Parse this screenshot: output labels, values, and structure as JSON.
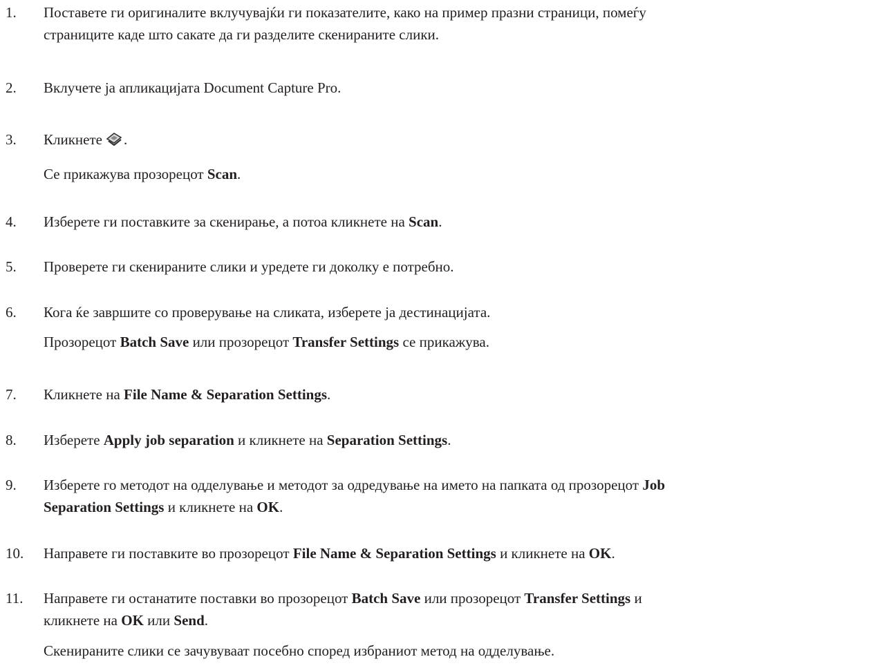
{
  "steps": [
    {
      "num": "1.",
      "line1": "Поставете ги оригиналите вклучувајќи ги показателите, како на пример празни страници, помеѓу",
      "line2": "страниците каде што сакате да ги разделите скенираните слики."
    },
    {
      "num": "2.",
      "text": "Вклучете ја апликацијата Document Capture Pro."
    },
    {
      "num": "3.",
      "pre": "Кликнете",
      "post": ".",
      "icon": "scan-icon",
      "note_pre": "Се прикажува прозорецот ",
      "note_b": "Scan",
      "note_post": "."
    },
    {
      "num": "4.",
      "pre": "Изберете ги поставките за скенирање, а потоа кликнете на ",
      "b": "Scan",
      "post": "."
    },
    {
      "num": "5.",
      "text": "Проверете ги скенираните слики и уредете ги доколку е потребно."
    },
    {
      "num": "6.",
      "text": "Кога ќе завршите со проверување на сликата, изберете ја дестинацијата.",
      "note_pre": "Прозорецот ",
      "note_b1": "Batch Save",
      "note_mid": " или прозорецот ",
      "note_b2": "Transfer Settings",
      "note_post": " се прикажува."
    },
    {
      "num": "7.",
      "pre": "Кликнете на ",
      "b": "File Name & Separation Settings",
      "post": "."
    },
    {
      "num": "8.",
      "pre": "Изберете ",
      "b1": "Apply job separation",
      "mid": " и кликнете на ",
      "b2": "Separation Settings",
      "post": "."
    },
    {
      "num": "9.",
      "pre": "Изберете го методот на одделување и методот за одредување на името на папката од прозорецот ",
      "b1": "Job",
      "b1b": "Separation Settings",
      "mid": " и кликнете на ",
      "b2": "OK",
      "post": "."
    },
    {
      "num": "10.",
      "pre": "Направете ги поставките во прозорецот ",
      "b1": "File Name & Separation Settings",
      "mid": " и кликнете на ",
      "b2": "OK",
      "post": "."
    },
    {
      "num": "11.",
      "pre": "Направете ги останатите поставки во прозорецот ",
      "b1": "Batch Save",
      "mid": " или прозорецот ",
      "b2": "Transfer Settings",
      "post": " и",
      "line2_pre": "кликнете на ",
      "line2_b1": "OK",
      "line2_mid": " или ",
      "line2_b2": "Send",
      "line2_post": ".",
      "note": "Скенираните слики се зачувуваат посебно според избраниот метод на одделување."
    }
  ]
}
